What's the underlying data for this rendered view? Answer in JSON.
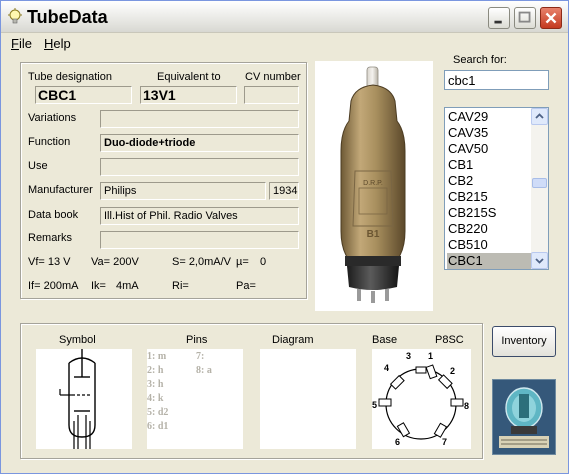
{
  "window": {
    "title": "TubeData",
    "title_icon": "lightbulb-icon"
  },
  "menu": {
    "items": [
      {
        "first": "F",
        "rest": "ile"
      },
      {
        "first": "H",
        "rest": "elp"
      }
    ]
  },
  "fields": {
    "tube_designation_label": "Tube designation",
    "equivalent_label": "Equivalent to",
    "cv_label": "CV number",
    "tube_designation": "CBC1",
    "equivalent": "13V1",
    "cv_number": "",
    "variations_label": "Variations",
    "variations": "",
    "function_label": "Function",
    "function": "Duo-diode+triode",
    "use_label": "Use",
    "use": "",
    "manufacturer_label": "Manufacturer",
    "manufacturer": "Philips",
    "year": "1934",
    "data_book_label": "Data book",
    "data_book": "Ill.Hist of Phil. Radio Valves",
    "remarks_label": "Remarks",
    "remarks": ""
  },
  "ratings": {
    "vf": "Vf= 13 V",
    "va": "Va= 200V",
    "s": "S= 2,0mA/V",
    "mu": "µ=",
    "mu_val": "0",
    "if": "If= 200mA",
    "ik": "Ik=",
    "ik_val": "4mA",
    "ri": "Ri=",
    "pa": "Pa="
  },
  "search": {
    "label": "Search for:",
    "value": "cbc1"
  },
  "tube_list": {
    "items": [
      "CAV29",
      "CAV35",
      "CAV50",
      "CB1",
      "CB2",
      "CB215",
      "CB215S",
      "CB220",
      "CB510",
      "CBC1"
    ],
    "selected": "CBC1"
  },
  "bottom": {
    "symbol_label": "Symbol",
    "pins_label": "Pins",
    "diagram_label": "Diagram",
    "base_label": "Base",
    "base_code": "P8SC",
    "pins_col1": [
      "1: m",
      "2: h",
      "3: h",
      "4: k",
      "5: d2",
      "6: d1"
    ],
    "pins_col2": [
      "7:",
      "8: a"
    ],
    "base_pin_numbers": [
      "1",
      "2",
      "3",
      "4",
      "5",
      "6",
      "7",
      "8"
    ]
  },
  "inventory_button": "Inventory",
  "photo_text": {
    "tube_label": "D.R.P.",
    "base_mark": "B1"
  },
  "colors": {
    "selected_item": "#bcbbb3",
    "close_button": "#c4391f",
    "logo_bg": "#3a5f84"
  }
}
